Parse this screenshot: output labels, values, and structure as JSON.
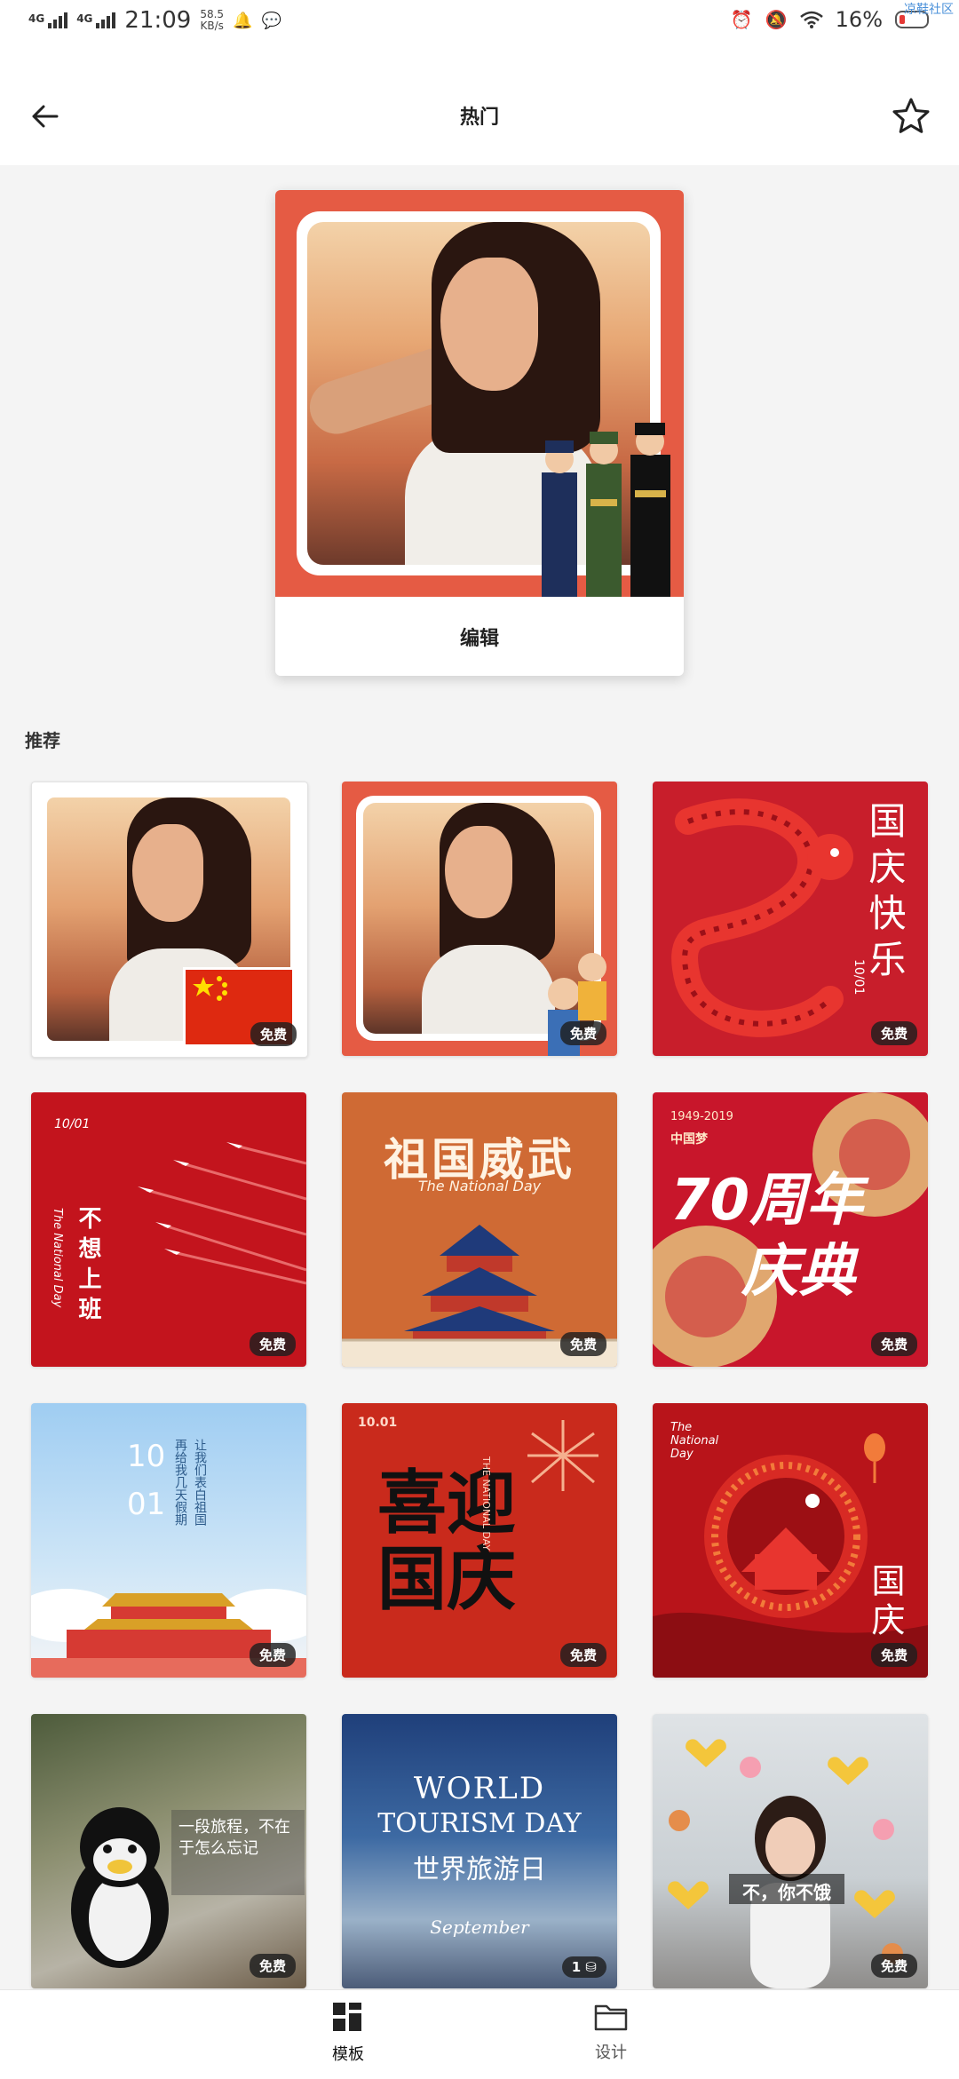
{
  "status_bar": {
    "network_1": "4G",
    "network_2": "4G",
    "time": "21:09",
    "speed_value": "58.5",
    "speed_unit": "KB/s",
    "battery": "16%",
    "watermark": "凉鞋社区"
  },
  "header": {
    "title": "热门"
  },
  "hero": {
    "edit_label": "编辑"
  },
  "section": {
    "title": "推荐"
  },
  "tiles": [
    {
      "badge": "免费"
    },
    {
      "badge": "免费"
    },
    {
      "title": "国庆快乐",
      "date": "10/01",
      "badge": "免费"
    },
    {
      "date": "10/01",
      "subtitle": "The National Day",
      "title": "不想上班",
      "badge": "免费"
    },
    {
      "title": "祖国威武",
      "subtitle": "The National Day",
      "badge": "免费"
    },
    {
      "years": "1949-2019",
      "tag": "中国梦",
      "title_1": "70周年",
      "title_2": "庆典",
      "badge": "免费"
    },
    {
      "date_1": "10",
      "date_2": "01",
      "poem": "让我们表白祖国",
      "poem_2": "再给我几天假期",
      "badge": "免费"
    },
    {
      "date": "10.01",
      "title": "喜迎国庆",
      "subtitle": "THE NATIONAL DAY",
      "badge": "免费"
    },
    {
      "subtitle": "The National Day",
      "title": "国庆",
      "badge": "免费"
    },
    {
      "quote": "一段旅程，不在于怎么忘记",
      "badge": "免费"
    },
    {
      "title_en_1": "WORLD",
      "title_en_2": "TOURISM DAY",
      "title_cn": "世界旅游日",
      "month": "September",
      "badge": "1"
    },
    {
      "caption": "不，你不饿",
      "badge": "免费"
    }
  ],
  "nav": {
    "templates": "模板",
    "design": "设计"
  }
}
